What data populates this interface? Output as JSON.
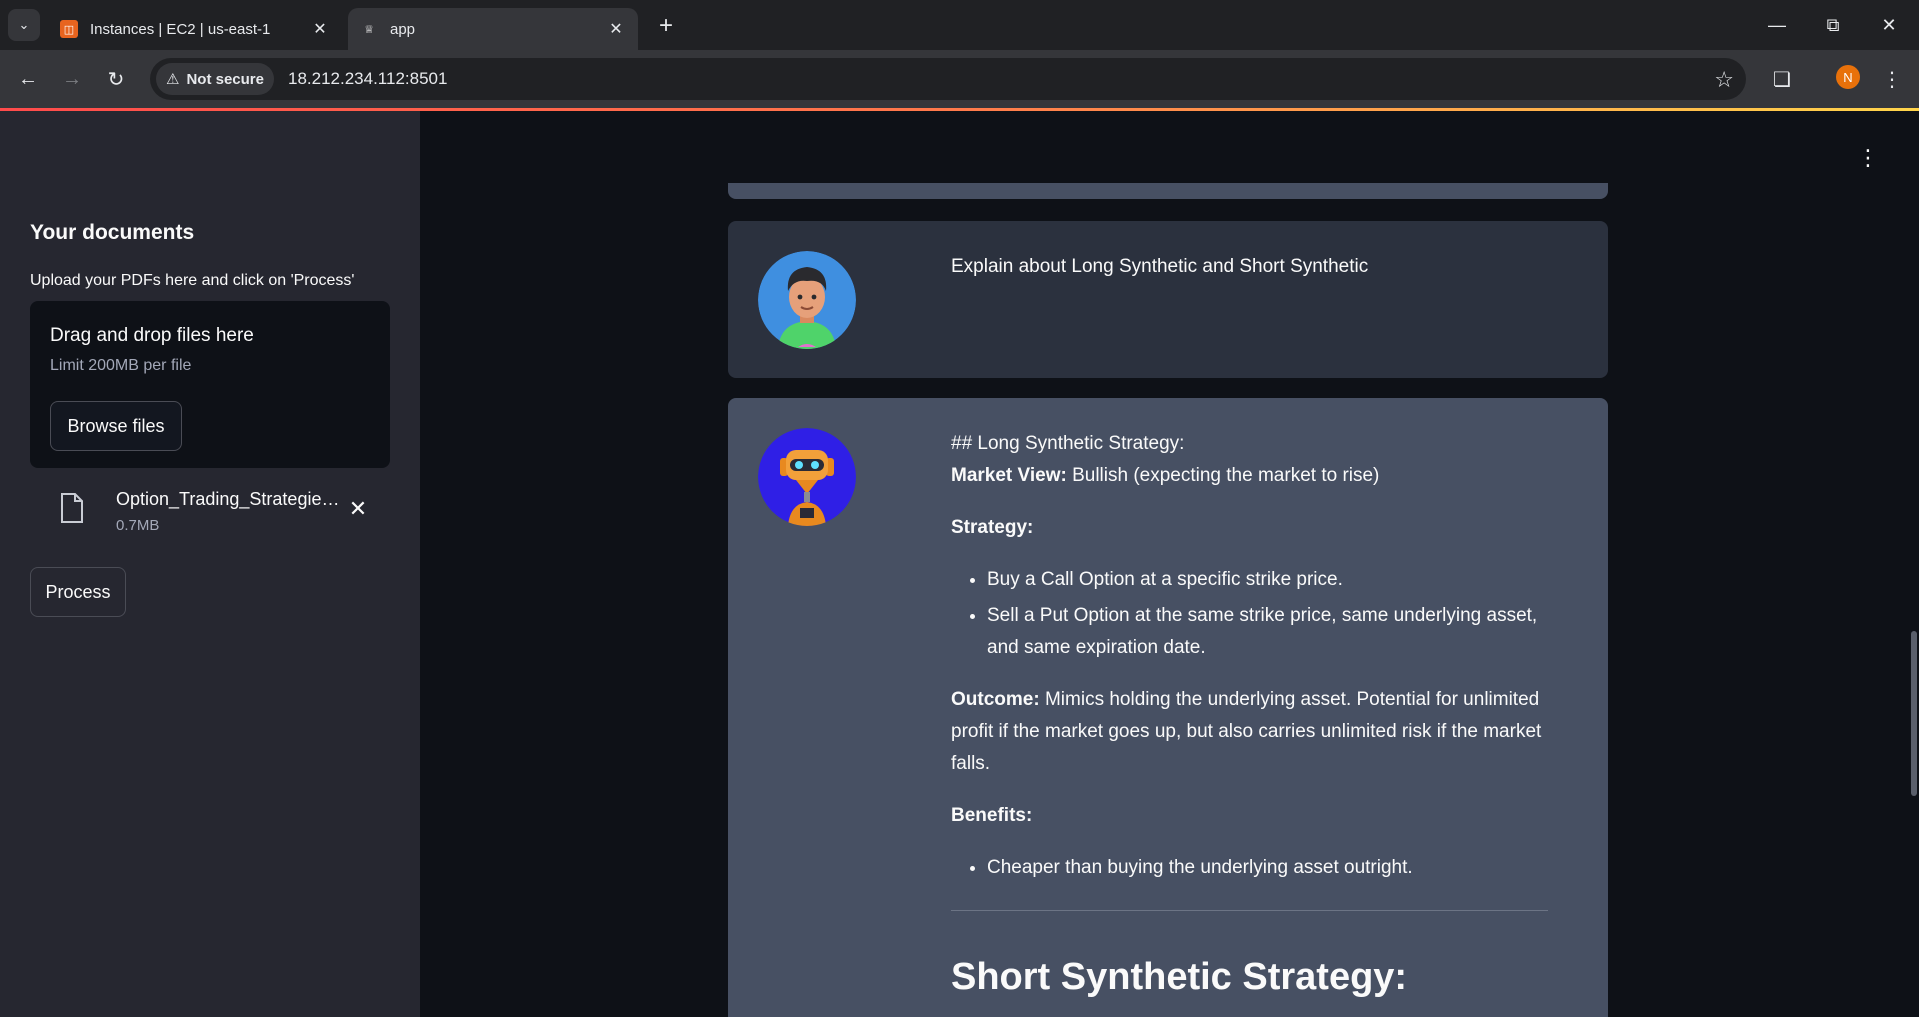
{
  "browser": {
    "tabs": [
      {
        "title": "Instances | EC2 | us-east-1",
        "icon": "aws-icon",
        "active": false
      },
      {
        "title": "app",
        "icon": "streamlit-crown-icon",
        "active": true
      }
    ],
    "security_label": "Not secure",
    "url": "18.212.234.112:8501",
    "profile_initial": "N"
  },
  "sidebar": {
    "title": "Your documents",
    "subtitle": "Upload your PDFs here and click on 'Process'",
    "dropzone": {
      "title": "Drag and drop files here",
      "limit": "Limit 200MB per file",
      "browse_label": "Browse files"
    },
    "file": {
      "name": "Option_Trading_Strategies.pdf",
      "size": "0.7MB"
    },
    "process_label": "Process"
  },
  "chat": {
    "user_message": "Explain about Long Synthetic and Short Synthetic",
    "bot_message": {
      "heading_raw": "## Long Synthetic Strategy:",
      "market_view_label": "Market View:",
      "market_view_text": " Bullish (expecting the market to rise)",
      "strategy_label": "Strategy:",
      "strategy_items": [
        "Buy a Call Option at a specific strike price.",
        "Sell a Put Option at the same strike price, same underlying asset, and same expiration date."
      ],
      "outcome_label": "Outcome:",
      "outcome_text": " Mimics holding the underlying asset. Potential for unlimited profit if the market goes up, but also carries unlimited risk if the market falls.",
      "benefits_label": "Benefits:",
      "benefits_items": [
        "Cheaper than buying the underlying asset outright."
      ],
      "next_heading": "Short Synthetic Strategy:"
    }
  },
  "colors": {
    "app_bg": "#0e1117",
    "sidebar_bg": "#262730",
    "user_msg_bg": "#2b313e",
    "bot_msg_bg": "#475063",
    "accent": "#ff4b4b"
  }
}
